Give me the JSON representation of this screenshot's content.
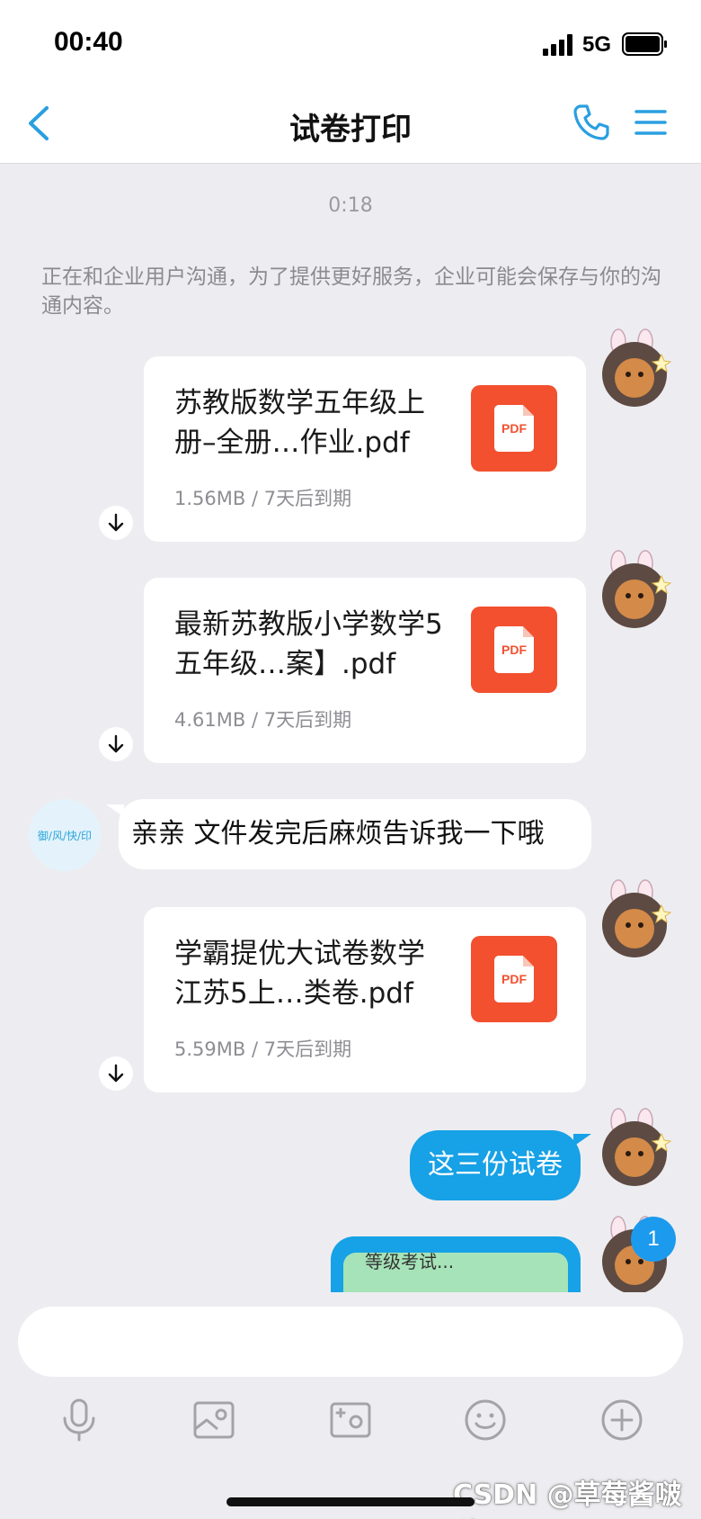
{
  "status_bar": {
    "time": "00:40",
    "network": "5G"
  },
  "nav": {
    "title": "试卷打印",
    "accent_color": "#2a9fe0"
  },
  "chat": {
    "timestamp": "0:18",
    "notice": "正在和企业用户沟通，为了提供更好服务，企业可能会保存与你的沟通内容。",
    "files": [
      {
        "name": "苏教版数学五年级上册–全册…作业.pdf",
        "size": "1.56MB",
        "expiry": "7天后到期"
      },
      {
        "name": "最新苏教版小学数学5五年级…案】.pdf",
        "size": "4.61MB",
        "expiry": "7天后到期"
      },
      {
        "name": "学霸提优大试卷数学江苏5上…类卷.pdf",
        "size": "5.59MB",
        "expiry": "7天后到期"
      }
    ],
    "pdf_icon_label": "PDF",
    "meta_separator": "/",
    "incoming_message": "亲亲 文件发完后麻烦告诉我一下哦",
    "incoming_avatar_text": "御/风/快/印",
    "outgoing_message": "这三份试卷",
    "image_preview_text": "等级考试...",
    "unread_count": "1"
  },
  "composer": {
    "input_placeholder": "",
    "tools": [
      "mic-icon",
      "image-icon",
      "camera-icon",
      "emoji-icon",
      "plus-icon"
    ]
  },
  "watermark": "CSDN @草莓酱啵啵"
}
